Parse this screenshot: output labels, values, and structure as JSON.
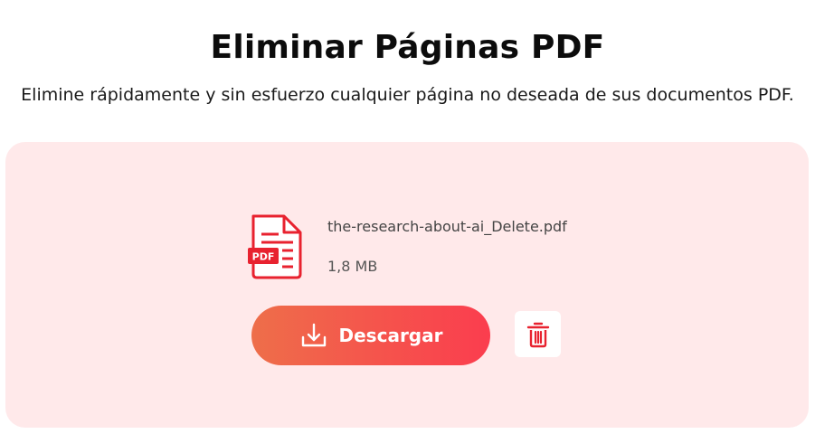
{
  "header": {
    "title": "Eliminar Páginas PDF",
    "subtitle": "Elimine rápidamente y sin esfuerzo cualquier página no deseada de sus documentos PDF."
  },
  "file": {
    "icon": "pdf-file-icon",
    "badge": "PDF",
    "name": "the-research-about-ai_Delete.pdf",
    "size": "1,8 MB"
  },
  "actions": {
    "download_label": "Descargar",
    "download_icon": "download-icon",
    "delete_icon": "trash-icon"
  },
  "colors": {
    "panel_bg": "#ffe9ea",
    "accent_red": "#e8222f",
    "button_gradient_start": "#ee6e4a",
    "button_gradient_end": "#fb3d4e"
  }
}
